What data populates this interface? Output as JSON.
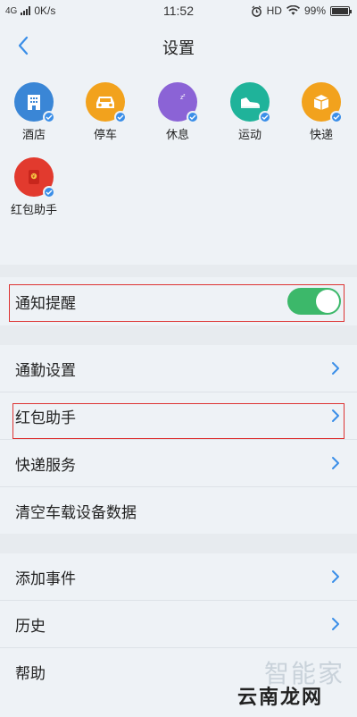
{
  "status_bar": {
    "network": "4G",
    "speed": "0K/s",
    "time": "11:52",
    "hd": "HD",
    "battery": "99%",
    "battery_level": 0.99
  },
  "nav": {
    "title": "设置"
  },
  "shortcuts": [
    {
      "label": "酒店",
      "icon": "hotel-building-icon",
      "color": "#3a86d6"
    },
    {
      "label": "停车",
      "icon": "car-icon",
      "color": "#f2a21d"
    },
    {
      "label": "休息",
      "icon": "moon-sleep-icon",
      "color": "#8b63d6"
    },
    {
      "label": "运动",
      "icon": "sneaker-icon",
      "color": "#1fb39a"
    },
    {
      "label": "快递",
      "icon": "package-icon",
      "color": "#f2a21d"
    },
    {
      "label": "红包助手",
      "icon": "red-envelope-icon",
      "color": "#e23a2e"
    }
  ],
  "notify": {
    "label": "通知提醒",
    "enabled": true
  },
  "menu": {
    "commute": "通勤设置",
    "redpacket": "红包助手",
    "express": "快递服务",
    "clear_car": "清空车载设备数据",
    "add_event": "添加事件",
    "history": "历史",
    "help": "帮助"
  },
  "watermark": {
    "top": "智能家",
    "bottom": "云南龙网"
  },
  "colors": {
    "accent": "#3a8ee8",
    "toggle_on": "#3cb86a",
    "highlight_box": "#dd3333"
  }
}
